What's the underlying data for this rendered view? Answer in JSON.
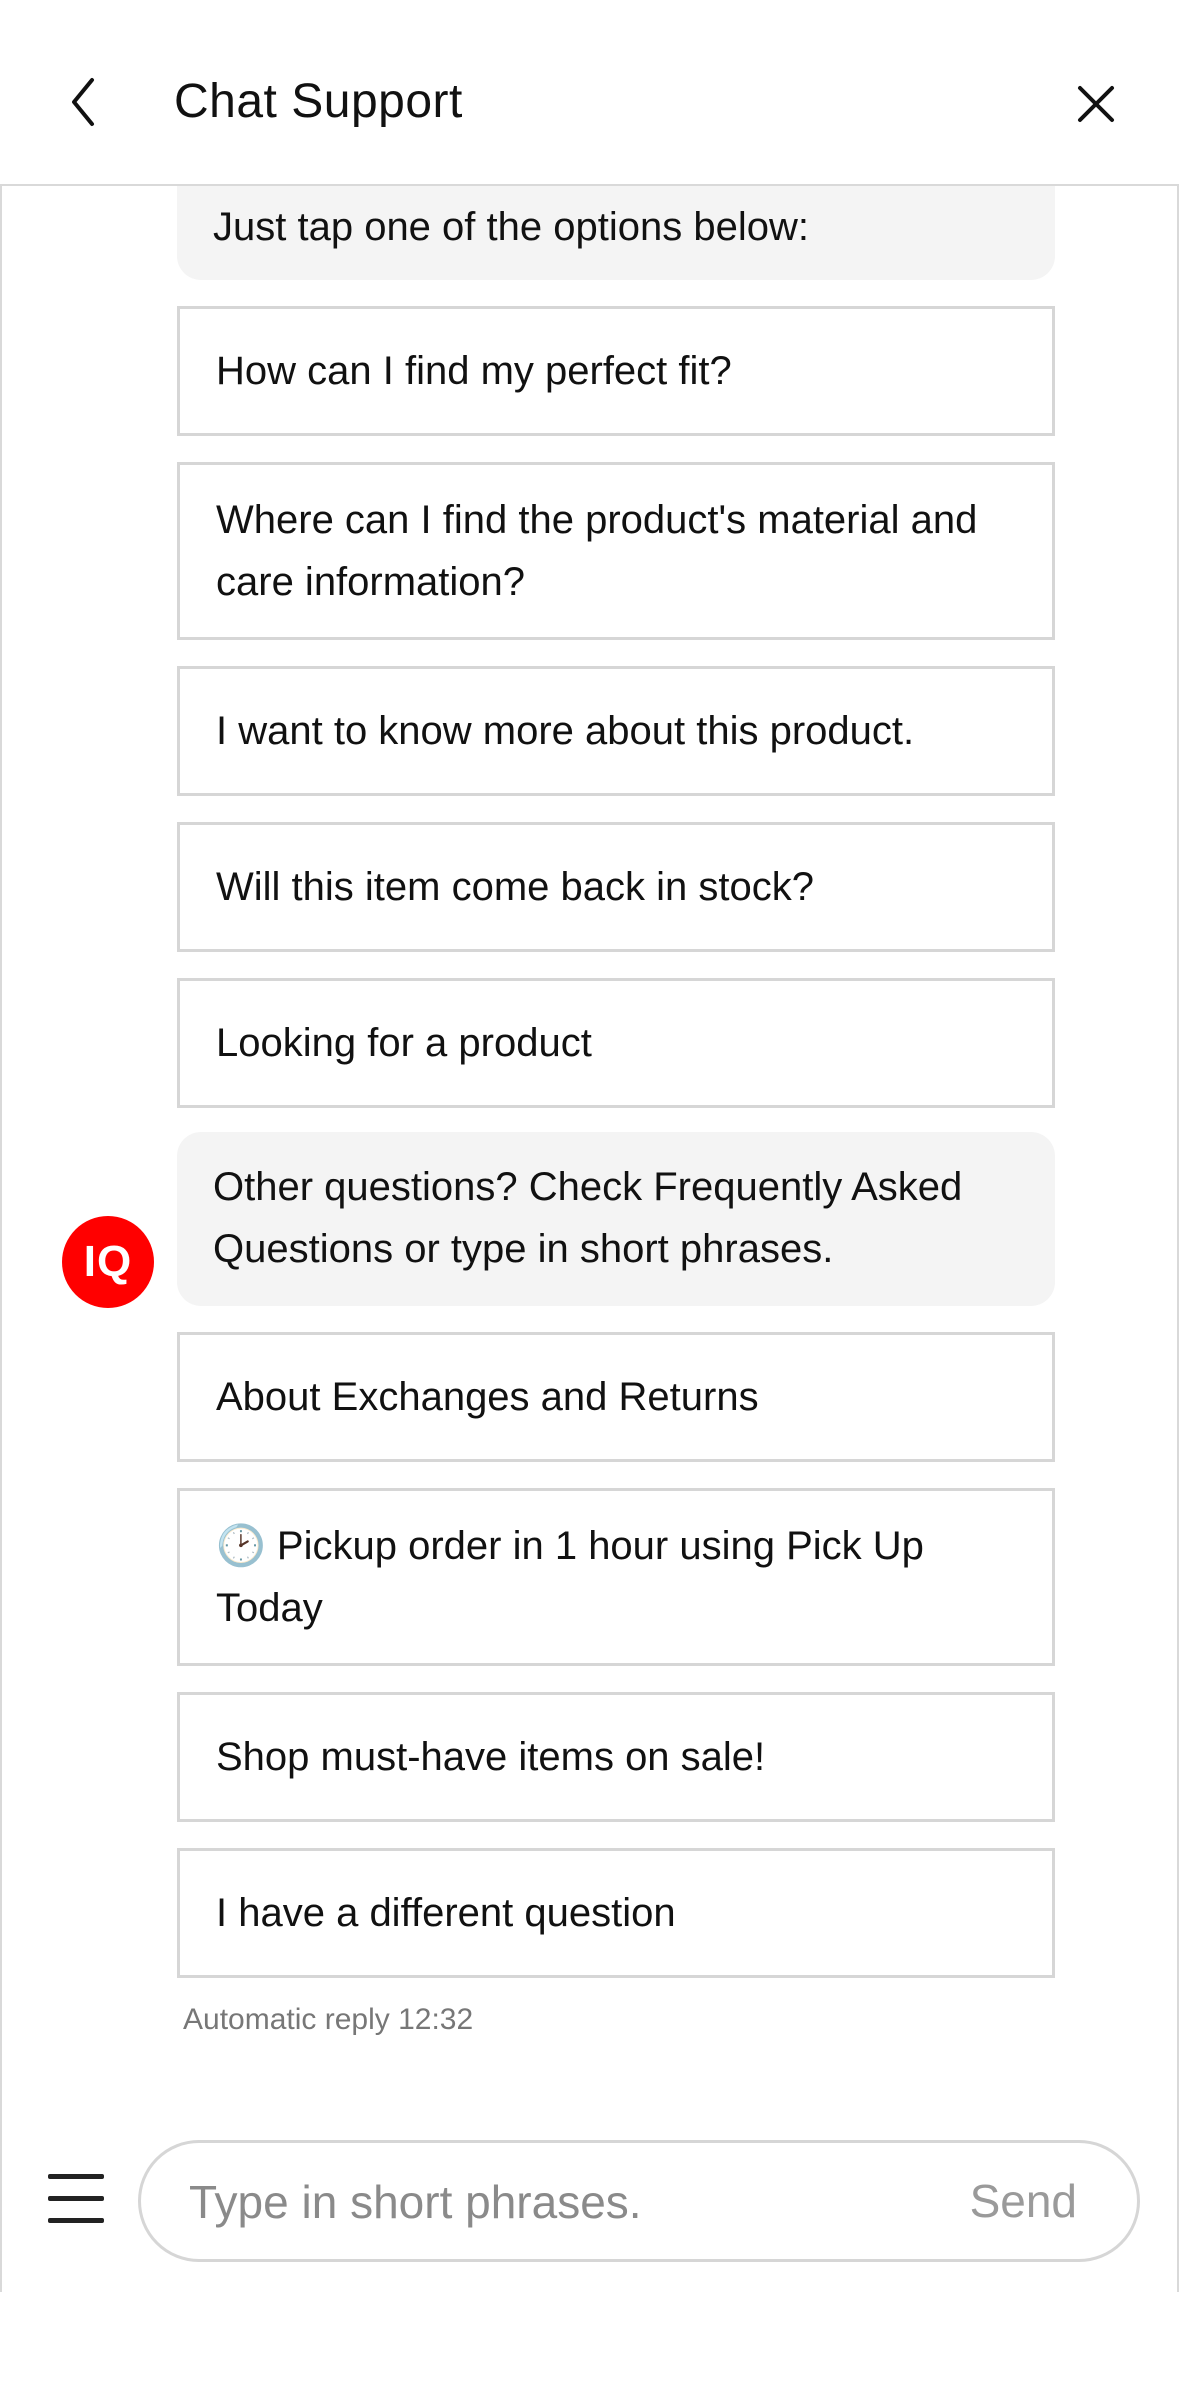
{
  "header": {
    "title": "Chat Support",
    "back_icon": "chevron-left-icon",
    "close_icon": "close-icon"
  },
  "messages": {
    "intro": "Just tap one of the options below:",
    "options_1": [
      "How can I find my perfect fit?",
      "Where can I find the product's material and care information?",
      "I want to know more about this product.",
      "Will this item come back in stock?",
      "Looking for a product"
    ],
    "other": "Other questions? Check Frequently Asked Questions or type in short phrases.",
    "avatar_label": "IQ",
    "options_2": [
      "About Exchanges and Returns",
      "🕑 Pickup order in 1 hour using Pick Up Today",
      "Shop must-have items on sale!",
      "I have a different question"
    ],
    "timestamp": "Automatic reply 12:32"
  },
  "composer": {
    "menu_icon": "hamburger-menu-icon",
    "placeholder": "Type in short phrases.",
    "send_label": "Send"
  },
  "colors": {
    "brand": "#ff0000",
    "bubble": "#f4f4f4",
    "border": "#d6d6d6",
    "muted": "#777777"
  }
}
